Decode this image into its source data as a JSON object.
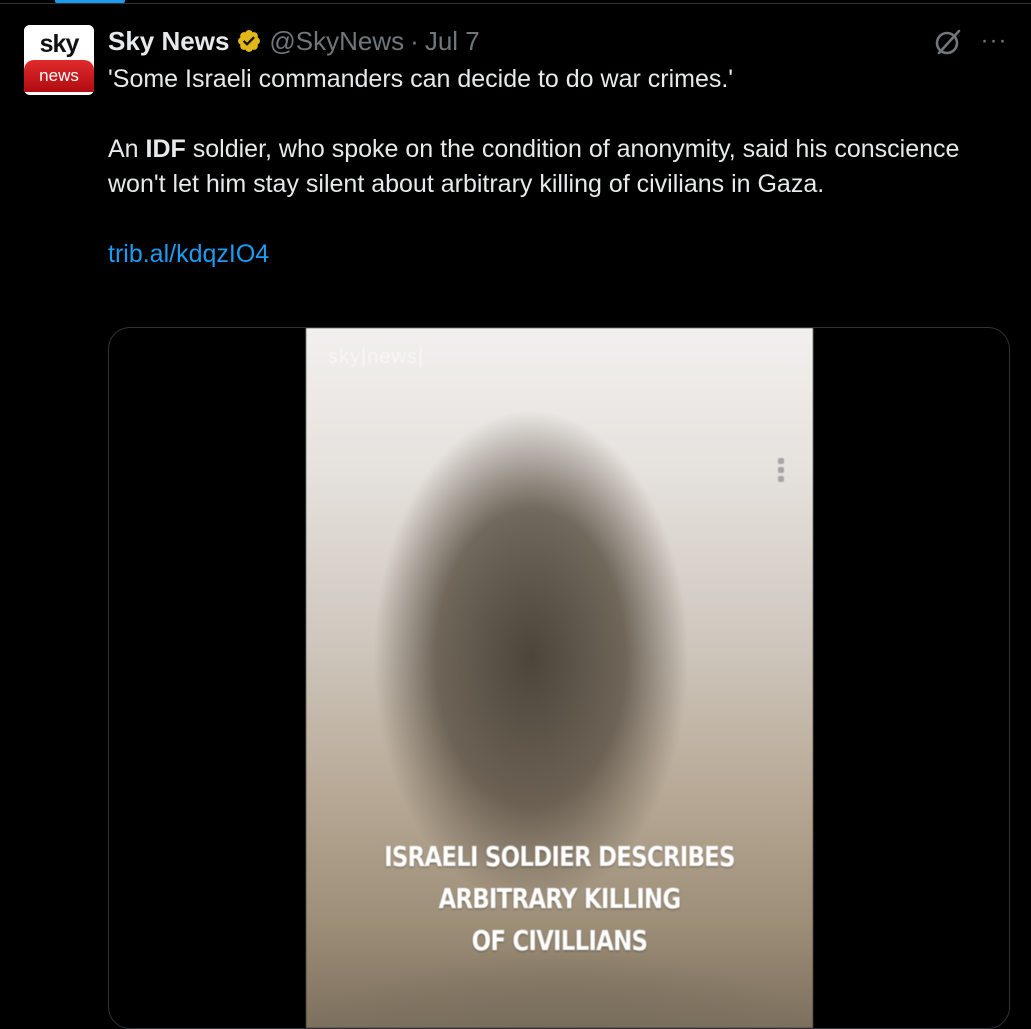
{
  "tweet": {
    "avatar": {
      "top_text": "sky",
      "bottom_text": "news"
    },
    "author_name": "Sky News",
    "handle": "@SkyNews",
    "separator": "·",
    "date": "Jul 7",
    "more_label": "···",
    "headline": "'Some Israeli commanders can decide to do war crimes.'",
    "body_prefix": "An ",
    "body_bold": "IDF",
    "body_suffix": " soldier, who spoke on the condition of anonymity, said his conscience won't let him stay silent about arbitrary killing of civilians in Gaza.",
    "link": "trib.al/kdqzIO4"
  },
  "video": {
    "watermark": "sky|news|",
    "caption_lines": [
      "ISRAELI SOLDIER DESCRIBES",
      "ARBITRARY KILLING",
      "OF CIVILLIANS"
    ]
  },
  "colors": {
    "background": "#000000",
    "text": "#e7e9ea",
    "muted": "#71767b",
    "link": "#1d9bf0",
    "verified_badge": "#e2b719"
  }
}
